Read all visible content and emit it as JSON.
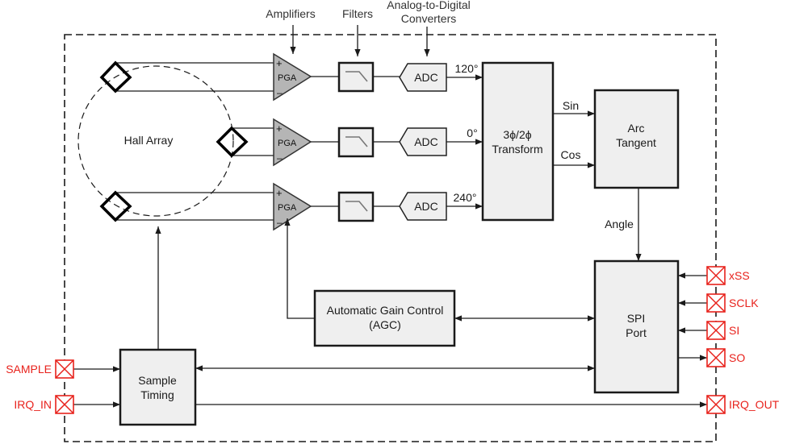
{
  "top_labels": {
    "amplifiers": "Amplifiers",
    "filters": "Filters",
    "adc_line1": "Analog-to-Digital",
    "adc_line2": "Converters"
  },
  "hall_array": "Hall Array",
  "pga_label": "PGA",
  "plus": "+",
  "minus": "–",
  "adc_label": "ADC",
  "phases": [
    "120°",
    "0°",
    "240°"
  ],
  "transform": {
    "line1": "3ϕ/2ϕ",
    "line2": "Transform"
  },
  "signals": {
    "sin": "Sin",
    "cos": "Cos",
    "angle": "Angle"
  },
  "arc_tangent": {
    "line1": "Arc",
    "line2": "Tangent"
  },
  "spi_port": {
    "line1": "SPI",
    "line2": "Port"
  },
  "agc": {
    "line1": "Automatic Gain Control",
    "line2": "(AGC)"
  },
  "sample_timing": {
    "line1": "Sample",
    "line2": "Timing"
  },
  "pins": {
    "xss": "xSS",
    "sclk": "SCLK",
    "si": "SI",
    "so": "SO",
    "irq_out": "IRQ_OUT",
    "sample": "SAMPLE",
    "irq_in": "IRQ_IN"
  },
  "colors": {
    "pin": "#e8221c",
    "block_fill": "#efefef",
    "amp_fill": "#b5b5b5"
  }
}
